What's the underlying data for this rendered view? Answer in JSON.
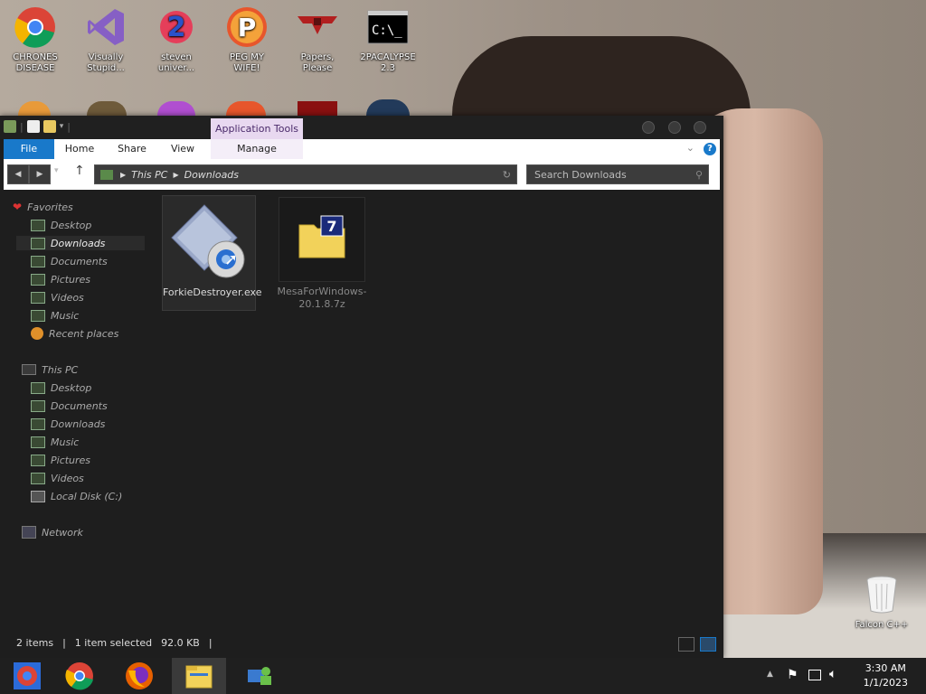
{
  "desktop": {
    "icons": [
      {
        "label": "CHRONES DISEASE",
        "icon": "chrome-icon"
      },
      {
        "label": "Visually Stupid...",
        "icon": "visual-studio-icon"
      },
      {
        "label": "steven univer...",
        "icon": "steven-universe-icon"
      },
      {
        "label": "PEG MY WIFE!",
        "icon": "peggle-icon"
      },
      {
        "label": "Papers, Please",
        "icon": "papers-please-icon"
      },
      {
        "label": "2PACALYPSE 2.3",
        "icon": "cmd-icon"
      }
    ],
    "recycle_bin": {
      "label": "Falcon C++",
      "icon": "recycle-bin-icon"
    }
  },
  "explorer": {
    "ribbon": {
      "context_tab": "Application Tools",
      "tabs": [
        "File",
        "Home",
        "Share",
        "View",
        "Manage"
      ]
    },
    "address": {
      "segments": [
        "This PC",
        "Downloads"
      ]
    },
    "search_placeholder": "Search Downloads",
    "sidebar": {
      "favorites_label": "Favorites",
      "favorites": [
        "Desktop",
        "Downloads",
        "Documents",
        "Pictures",
        "Videos",
        "Music",
        "Recent places"
      ],
      "thispc_label": "This PC",
      "thispc": [
        "Desktop",
        "Documents",
        "Downloads",
        "Music",
        "Pictures",
        "Videos",
        "Local Disk (C:)"
      ],
      "network_label": "Network",
      "selected": "Downloads"
    },
    "files": [
      {
        "name": "ForkieDestroyer.exe",
        "icon": "application-gear-icon",
        "selected": true
      },
      {
        "name": "MesaForWindows-20.1.8.7z",
        "icon": "7zip-archive-icon",
        "selected": false
      }
    ],
    "status": {
      "items": "2 items",
      "selected": "1 item selected",
      "size": "92.0 KB"
    }
  },
  "taskbar": {
    "apps": [
      "chrome-multi-icon",
      "chrome-icon",
      "firefox-icon",
      "file-explorer-icon",
      "network-people-icon"
    ],
    "time": "3:30 AM",
    "date": "1/1/2023"
  },
  "colors": {
    "file_tab": "#1979ca",
    "explorer_bg": "#1e1e1e",
    "context_tab": "#e8d8f0"
  }
}
